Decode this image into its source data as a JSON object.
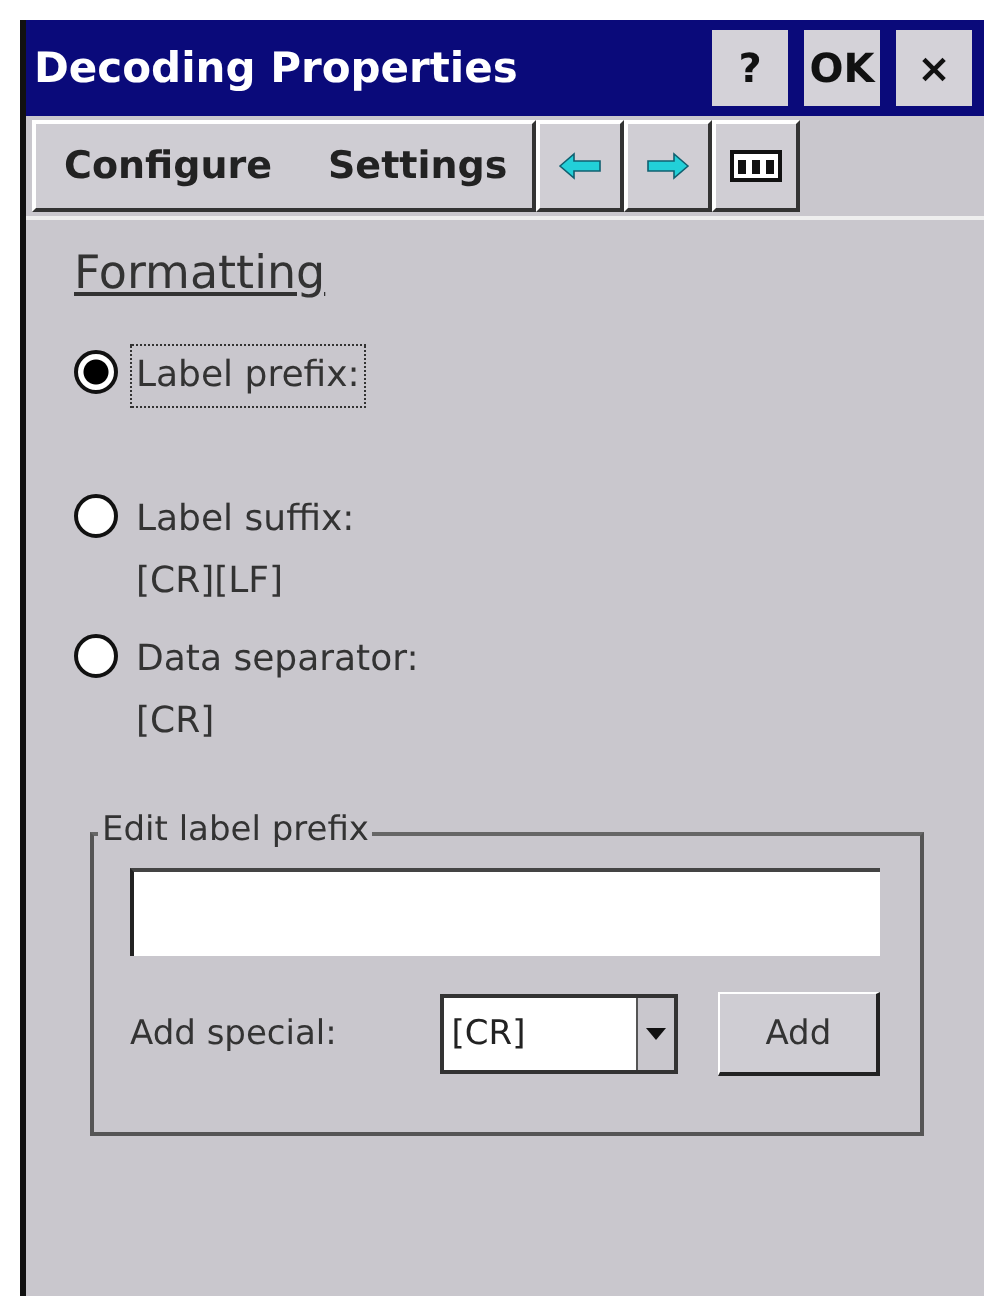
{
  "window": {
    "title": "Decoding Properties"
  },
  "title_buttons": [
    {
      "label": "?"
    },
    {
      "label": "OK"
    },
    {
      "label": "×"
    }
  ],
  "menu": [
    {
      "label": "Configure"
    },
    {
      "label": "Settings"
    }
  ],
  "section": "Formatting",
  "options": [
    {
      "label": "Label prefix:",
      "selected": true,
      "focused": true
    },
    {
      "label": "Label suffix:",
      "value": "[CR][LF]",
      "selected": false,
      "focused": false
    },
    {
      "label": "Data separator:",
      "value": "[CR]",
      "selected": false,
      "focused": false
    }
  ],
  "group": {
    "title": "Edit label prefix"
  },
  "special": {
    "label": "Add special:",
    "value": "[CR]"
  },
  "add_button": "Add"
}
